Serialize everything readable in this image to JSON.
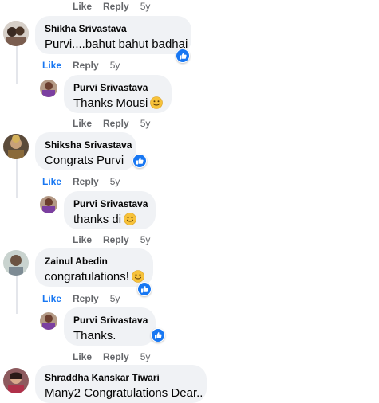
{
  "colors": {
    "bubble": "#f0f2f5",
    "accent": "#1877f2",
    "meta": "#65676b",
    "background": "#ffffff"
  },
  "top_actions": {
    "like": "Like",
    "reply": "Reply",
    "time": "5y"
  },
  "comments": [
    {
      "name": "Shikha Srivastava",
      "text": "Purvi....bahut bahut badhai",
      "has_like_reaction": true,
      "emoji": null,
      "actions": {
        "like": "Like",
        "reply": "Reply",
        "time": "5y",
        "liked": true
      }
    },
    {
      "name": "Purvi Srivastava",
      "text": "Thanks Mousi",
      "has_like_reaction": false,
      "emoji": "smiley-emoji",
      "actions": {
        "like": "Like",
        "reply": "Reply",
        "time": "5y",
        "liked": false
      }
    },
    {
      "name": "Shiksha Srivastava",
      "text": "Congrats Purvi",
      "has_like_reaction": true,
      "emoji": null,
      "actions": {
        "like": "Like",
        "reply": "Reply",
        "time": "5y",
        "liked": true
      }
    },
    {
      "name": "Purvi Srivastava",
      "text": "thanks di",
      "has_like_reaction": false,
      "emoji": "smiley-emoji",
      "actions": {
        "like": "Like",
        "reply": "Reply",
        "time": "5y",
        "liked": false
      }
    },
    {
      "name": "Zainul Abedin",
      "text": "congratulations!",
      "has_like_reaction": true,
      "emoji": "smiley-emoji",
      "actions": {
        "like": "Like",
        "reply": "Reply",
        "time": "5y",
        "liked": true
      }
    },
    {
      "name": "Purvi Srivastava",
      "text": "Thanks.",
      "has_like_reaction": true,
      "emoji": null,
      "actions": {
        "like": "Like",
        "reply": "Reply",
        "time": "5y",
        "liked": false
      }
    },
    {
      "name": "Shraddha Kanskar Tiwari",
      "text": "Many2 Congratulations Dear..",
      "has_like_reaction": false,
      "emoji": null
    }
  ]
}
